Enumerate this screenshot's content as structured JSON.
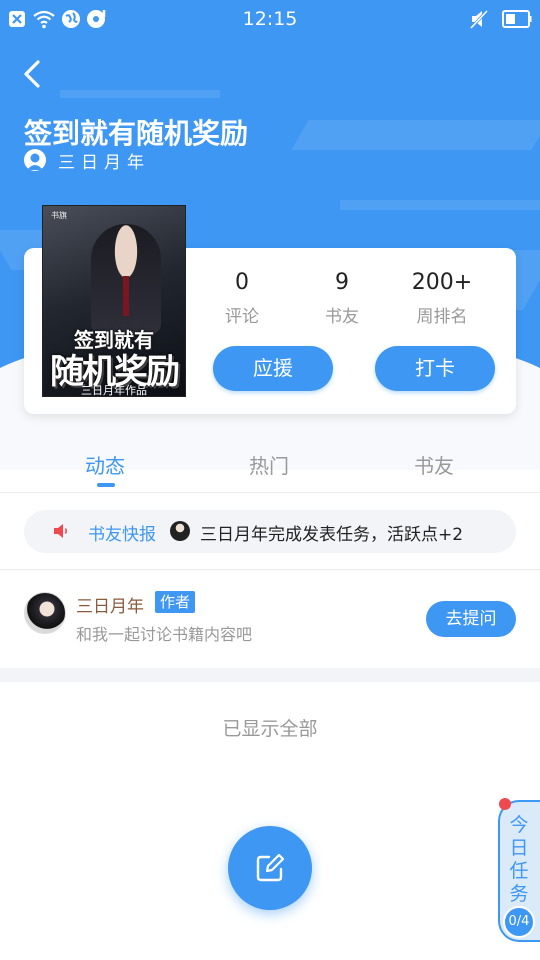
{
  "status_bar": {
    "time": "12:15",
    "icons": [
      "close-box-icon",
      "wifi-icon",
      "globe-icon",
      "music-icon",
      "mute-icon",
      "battery-icon"
    ]
  },
  "header": {
    "back_icon": "chevron-left-icon",
    "title": "签到就有随机奖励",
    "author": "三日月年"
  },
  "book": {
    "cover": {
      "logo": "书旗",
      "title_line1": "签到就有",
      "title_line2": "随机奖励",
      "author_line": "三日月年作品"
    },
    "stats": [
      {
        "value": "0",
        "label": "评论"
      },
      {
        "value": "9",
        "label": "书友"
      },
      {
        "value": "200+",
        "label": "周排名"
      }
    ],
    "support_button": "应援",
    "checkin_button": "打卡"
  },
  "tabs": [
    {
      "label": "动态",
      "active": true
    },
    {
      "label": "热门",
      "active": false
    },
    {
      "label": "书友",
      "active": false
    }
  ],
  "news": {
    "icon": "speaker-icon",
    "label": "书友快报",
    "text": "三日月年完成发表任务，活跃点+2"
  },
  "post": {
    "name": "三日月年",
    "badge": "作者",
    "description": "和我一起讨论书籍内容吧",
    "ask_button": "去提问"
  },
  "footer_text": "已显示全部",
  "fab": {
    "icon": "edit-icon"
  },
  "task_widget": {
    "label": "今日任务",
    "progress": "0/4"
  },
  "colors": {
    "accent": "#3d97f3",
    "badge_red": "#f0484f",
    "author_name": "#8a5a3c"
  }
}
